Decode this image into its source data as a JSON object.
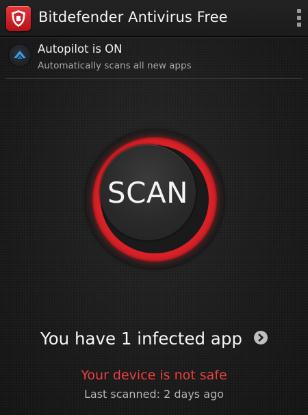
{
  "app": {
    "title": "Bitdefender Antivirus Free",
    "logo_icon": "bitdefender-shield-icon",
    "menu_icon": "overflow-menu-icon"
  },
  "autopilot": {
    "icon": "autopilot-chevron-icon",
    "title": "Autopilot is ON",
    "subtitle": "Automatically scans all new apps"
  },
  "scan": {
    "label": "SCAN",
    "ring_color": "#e3262c"
  },
  "status": {
    "infected_text": "You have 1 infected app",
    "detail_icon": "chevron-right-icon",
    "warning_text": "Your device is not safe",
    "warning_color": "#ee3d43",
    "last_scanned": "Last scanned: 2 days ago"
  }
}
